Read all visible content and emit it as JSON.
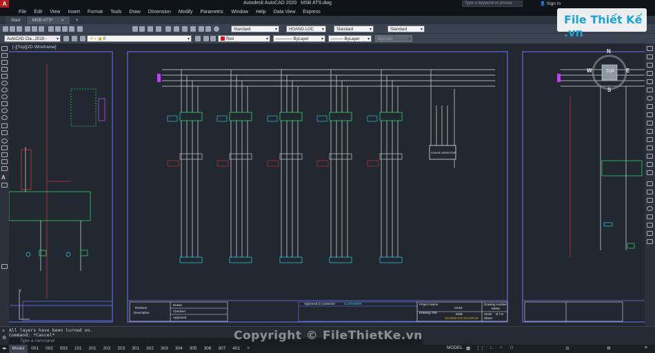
{
  "titlebar": {
    "app_title": "Autodesk AutoCAD 2020",
    "file_title": "MSB ATS.dwg",
    "search_placeholder": "Type a keyword or phrase",
    "sign_in": "Sign In"
  },
  "menu": [
    "File",
    "Edit",
    "View",
    "Insert",
    "Format",
    "Tools",
    "Draw",
    "Dimension",
    "Modify",
    "Parametric",
    "Window",
    "Help",
    "Data View",
    "Express"
  ],
  "file_tabs": [
    {
      "label": "Start"
    },
    {
      "label": "MSB ATS*"
    }
  ],
  "toolbar": {
    "text_style": "Standard",
    "dim_style": "HOANG LOC",
    "table_style": "Standard",
    "mleader_style": "Standard"
  },
  "properties_bar": {
    "workspace": "AutoCAD Cla...2018 - English",
    "layer": "0",
    "color": "Red",
    "linetype": "ByLayer",
    "lineweight": "ByLayer",
    "plotstyle": "ByColor"
  },
  "viewport": {
    "label": "[-][Top][2D Wireframe]",
    "viewcube": {
      "top": "TOP",
      "n": "N",
      "s": "S",
      "e": "E",
      "w": "W"
    }
  },
  "drawing": {
    "sheet_center_texts": {
      "approved_label": "Approved to Customer",
      "customer": "CUSTOMER",
      "revision": "Revision",
      "description": "Description",
      "drawn": "Drawn",
      "checked": "Checked",
      "approved": "Approved"
    },
    "title_block": {
      "project_name": "Project Name",
      "project_value": "CN16",
      "drawing_title": "Drawing Title",
      "title_value": "MSB",
      "schematic": "SCHEMATIC DIAGRAM",
      "drawing_number": "Drawing number",
      "drawing_number_value": "MS05",
      "scale": "Scale",
      "scale_value": "N.T.S",
      "sheet": "Sheet"
    },
    "surge_label": "SURGE ARRESTER"
  },
  "command": {
    "history": [
      "All layers have been turned on.",
      "Command: *Cancel*"
    ],
    "placeholder": "Type a command"
  },
  "layout_tabs": [
    "Model",
    "001",
    "002",
    "003",
    "101",
    "201",
    "202",
    "203",
    "301",
    "302",
    "303",
    "304",
    "305",
    "306",
    "307",
    "401"
  ],
  "status": {
    "model": "MODEL"
  },
  "watermark": "Copyright © FileThietKe.vn",
  "logo": "File Thiết Kế .vn"
}
